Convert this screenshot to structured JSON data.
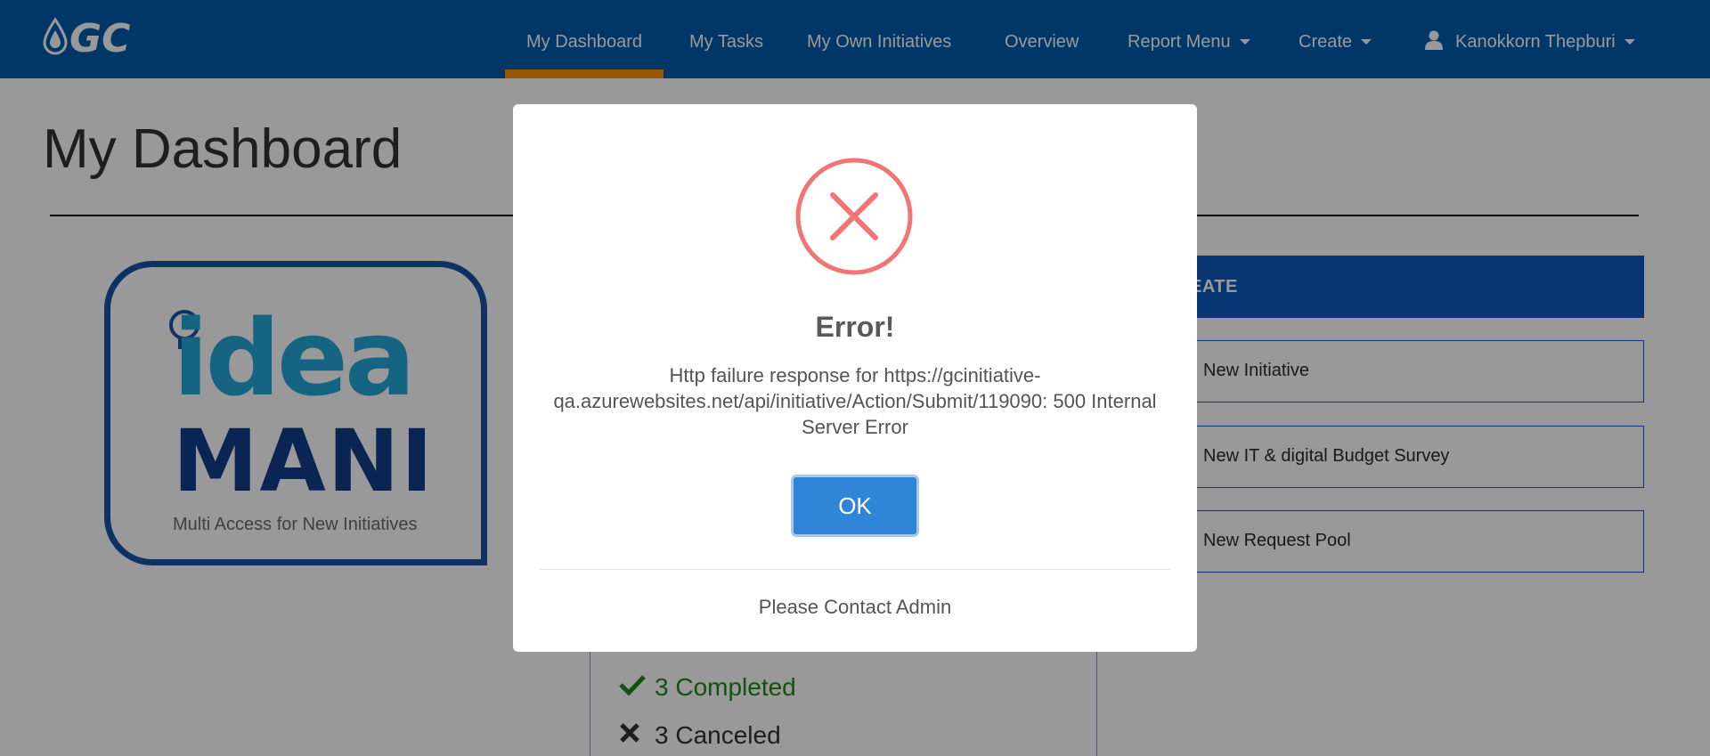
{
  "navbar": {
    "logo_text": "GC",
    "items": [
      {
        "label": "My Dashboard",
        "active": true
      },
      {
        "label": "My Tasks"
      },
      {
        "label": "My Own Initiatives"
      },
      {
        "label": "Overview"
      },
      {
        "label": "Report Menu",
        "dropdown": true
      },
      {
        "label": "Create",
        "dropdown": true
      }
    ],
    "user": {
      "name": "Kanokkorn Thepburi",
      "icon": "user-icon"
    },
    "colors": {
      "background": "#005cab",
      "active_underline": "#f39200"
    }
  },
  "page": {
    "title": "My Dashboard"
  },
  "brand": {
    "word1": "idea",
    "word2": "MANI",
    "tagline": "Multi Access for New Initiatives"
  },
  "create_panel": {
    "header_visible": "EATE",
    "buttons": [
      {
        "label": "New Initiative"
      },
      {
        "label": "New IT & digital Budget Survey"
      },
      {
        "label": "New Request Pool"
      }
    ]
  },
  "status_summary": {
    "items": [
      {
        "label": "3 Completed",
        "icon": "check-icon",
        "color": "#1e8a1e"
      },
      {
        "label": "3 Canceled",
        "icon": "cross-icon",
        "color": "#333333"
      }
    ]
  },
  "modal": {
    "icon": "error-x-icon",
    "title": "Error!",
    "message": "Http failure response for https://gcinitiative-qa.azurewebsites.net/api/initiative/Action/Submit/119090: 500 Internal Server Error",
    "ok_label": "OK",
    "footer": "Please Contact Admin",
    "colors": {
      "icon": "#f27474",
      "button": "#3085d6"
    }
  }
}
